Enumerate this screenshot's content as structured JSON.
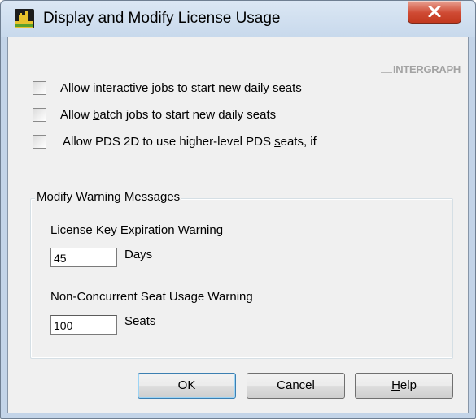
{
  "window": {
    "title": "Display and Modify License Usage",
    "close_glyph": "X",
    "icon": "app-icon"
  },
  "logo": {
    "text": "INTERGRAPH"
  },
  "checkboxes": [
    {
      "pre": "",
      "mnemonic": "A",
      "post": "llow interactive jobs to start new daily seats",
      "checked": false
    },
    {
      "pre": "Allow ",
      "mnemonic": "b",
      "post": "atch jobs to start new daily seats",
      "checked": false
    },
    {
      "pre": "Allow PDS 2D to use higher-level PDS ",
      "mnemonic": "s",
      "post": "eats, if",
      "checked": false
    }
  ],
  "group": {
    "legend": "Modify Warning Messages",
    "license_key": {
      "label": "License Key Expiration Warning",
      "value": "45",
      "unit": "Days"
    },
    "non_concurrent": {
      "label": "Non-Concurrent Seat Usage Warning",
      "value": "100",
      "unit": "Seats"
    }
  },
  "buttons": {
    "ok": "OK",
    "cancel": "Cancel",
    "help_mnemonic": "H",
    "help_rest": "elp"
  }
}
